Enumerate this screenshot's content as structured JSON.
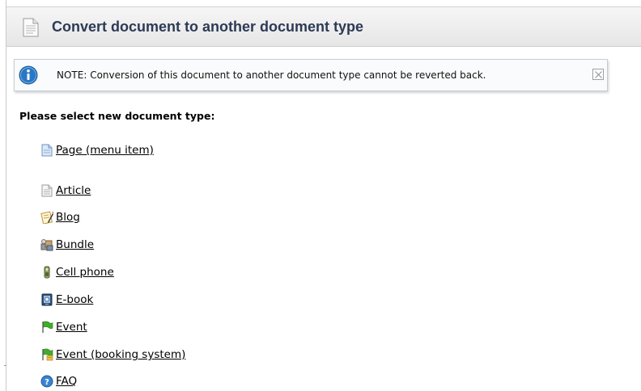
{
  "header": {
    "title": "Convert document to another document type",
    "icon": "document-icon"
  },
  "note": {
    "text": "NOTE: Conversion of this document to another document type cannot be reverted back.",
    "icon": "info-icon",
    "close_icon": "close-icon"
  },
  "instruction": "Please select new document type:",
  "doc_types": [
    {
      "label": "Page (menu item)",
      "icon": "page-icon"
    },
    {
      "label": "Article",
      "icon": "article-icon"
    },
    {
      "label": "Blog",
      "icon": "blog-icon"
    },
    {
      "label": "Bundle",
      "icon": "bundle-icon"
    },
    {
      "label": "Cell phone",
      "icon": "cell-phone-icon"
    },
    {
      "label": "E-book",
      "icon": "e-book-icon"
    },
    {
      "label": "Event",
      "icon": "event-flag-icon"
    },
    {
      "label": "Event (booking system)",
      "icon": "event-booking-icon"
    },
    {
      "label": "FAQ",
      "icon": "faq-icon"
    }
  ],
  "colors": {
    "header_title": "#2d3a55",
    "info_blue": "#2a78c4",
    "event_green": "#3fae2a"
  }
}
